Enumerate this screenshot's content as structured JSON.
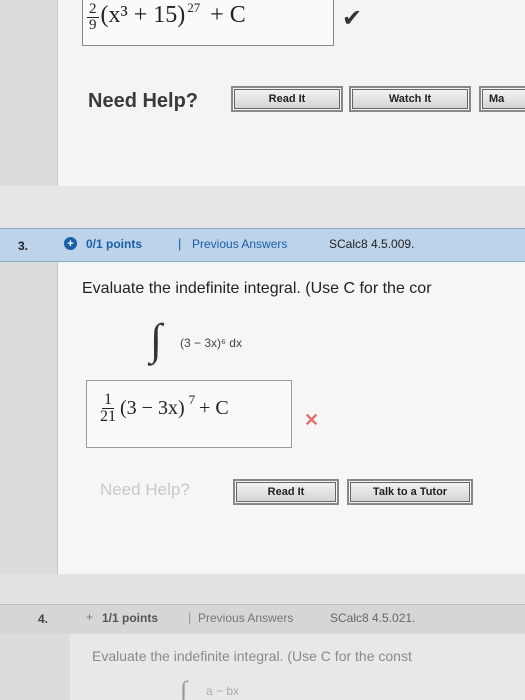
{
  "q2": {
    "answer": {
      "coef_num": "2",
      "coef_den": "9",
      "expr": "(x³ + 15)",
      "exp": "27",
      "plus_c": "+ C"
    },
    "check_icon": "checkmark-icon",
    "help_label": "Need Help?",
    "buttons": {
      "read": "Read It",
      "watch": "Watch It",
      "master": "Ma"
    }
  },
  "q3": {
    "number": "3.",
    "status_icon": "plus-circle-icon",
    "points": "0/1 points",
    "separator": "|",
    "previous_answers": "Previous Answers",
    "reference": "SCalc8 4.5.009.",
    "prompt": "Evaluate the indefinite integral. (Use C for the cor",
    "integral_sign": "∫",
    "integrand": "(3 − 3x)⁶ dx",
    "answer": {
      "coef_num": "1",
      "coef_den": "21",
      "expr": "(3 − 3x)",
      "exp": "7",
      "plus_c": "+ C"
    },
    "result_icon": "wrong-x-icon",
    "help_label": "Need Help?",
    "buttons": {
      "read": "Read It",
      "tutor": "Talk to a Tutor"
    }
  },
  "q4": {
    "number": "4.",
    "status_icon": "plus-icon",
    "points": "1/1 points",
    "separator": "|",
    "previous_answers": "Previous Answers",
    "reference": "SCalc8 4.5.021.",
    "prompt": "Evaluate the indefinite integral. (Use C for the const",
    "integral_sign": "∫",
    "integrand": "a − bx"
  }
}
